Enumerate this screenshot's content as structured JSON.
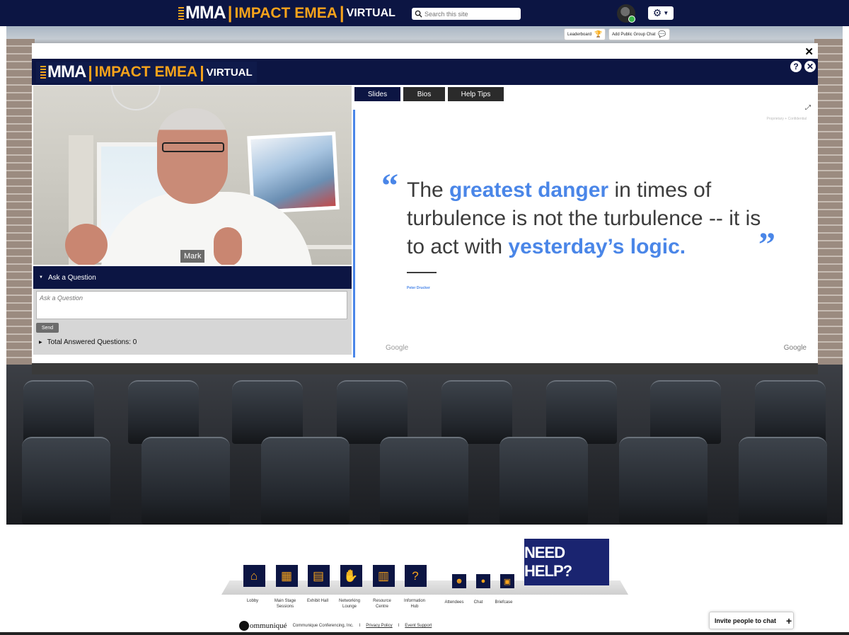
{
  "brand": {
    "mma": "MMA",
    "impact": "IMPACT EMEA",
    "virtual": "VIRTUAL",
    "accent_color": "#f6a31b",
    "navy_color": "#0c1543"
  },
  "search": {
    "placeholder": "Search this site"
  },
  "top_actions": {
    "leaderboard": "Leaderboard",
    "group_chat": "Add Public Group Chat"
  },
  "video": {
    "speaker_name": "Mark"
  },
  "ask": {
    "header": "Ask a Question",
    "placeholder": "Ask a Question",
    "send": "Send",
    "answered": "Total Answered Questions: 0"
  },
  "tabs": [
    {
      "label": "Slides",
      "active": true
    },
    {
      "label": "Bios",
      "active": false
    },
    {
      "label": "Help Tips",
      "active": false
    }
  ],
  "slide": {
    "meta": "Proprietary + Confidential",
    "quote_part1": "The ",
    "quote_hl1": "greatest danger",
    "quote_part2": " in times of turbulence is not the turbulence -- it is to act with ",
    "quote_hl2": "yesterday’s logic.",
    "author": "Peter Drucker",
    "footer_left": "Google",
    "footer_right": "Google"
  },
  "nav": {
    "items": [
      {
        "label": "Lobby",
        "icon": "home-icon"
      },
      {
        "label": "Main Stage Sessions",
        "icon": "stage-icon"
      },
      {
        "label": "Exhibit Hall",
        "icon": "exhibit-icon"
      },
      {
        "label": "Networking Lounge",
        "icon": "handshake-icon"
      },
      {
        "label": "Resource Centre",
        "icon": "library-icon"
      },
      {
        "label": "Information Hub",
        "icon": "info-gear-icon"
      },
      {
        "label": "Attendees",
        "icon": "attendees-icon"
      },
      {
        "label": "Chat",
        "icon": "chat-icon"
      },
      {
        "label": "Briefcase",
        "icon": "briefcase-icon"
      }
    ],
    "need_help": "NEED HELP?"
  },
  "footer": {
    "brand": "ommuniqué",
    "company": "Communique Conferencing, Inc.",
    "privacy": "Privacy Policy",
    "support": "Event Support",
    "divider": "I"
  },
  "invite": {
    "label": "Invite people to chat",
    "plus": "+"
  }
}
